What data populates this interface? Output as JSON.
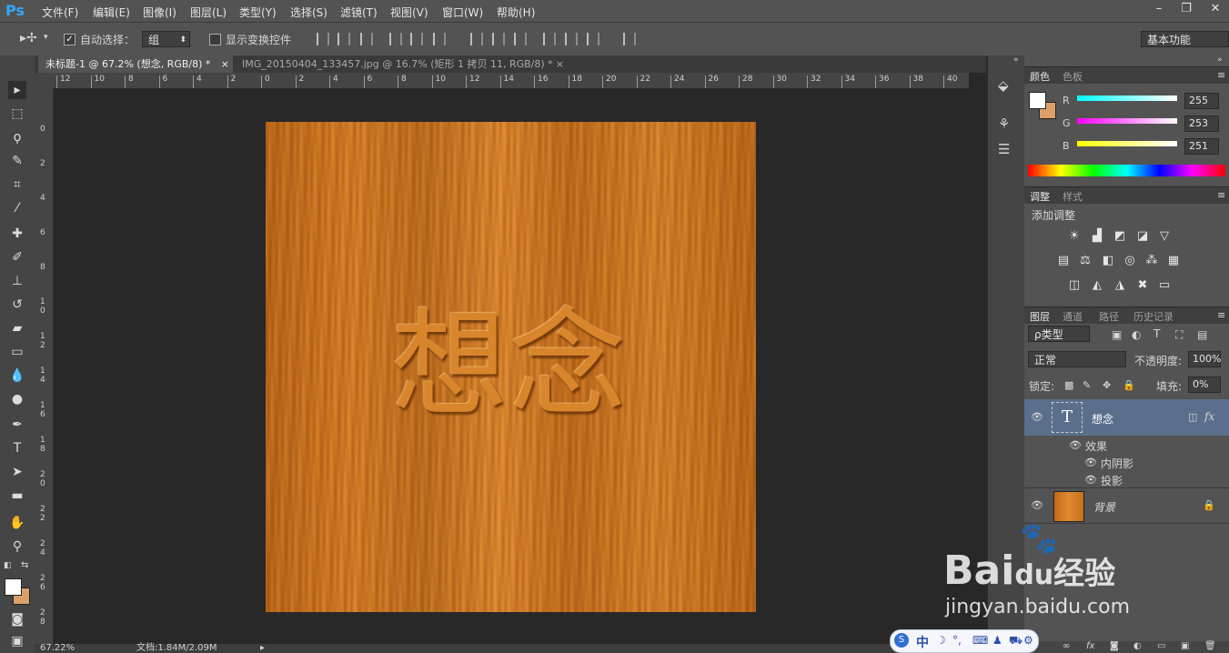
{
  "app": {
    "logo": "Ps"
  },
  "menu": [
    "文件(F)",
    "编辑(E)",
    "图像(I)",
    "图层(L)",
    "类型(Y)",
    "选择(S)",
    "滤镜(T)",
    "视图(V)",
    "窗口(W)",
    "帮助(H)"
  ],
  "window_controls": {
    "minimize": "–",
    "restore": "❐",
    "close": "✕"
  },
  "options": {
    "auto_select_label": "自动选择：",
    "auto_select_checked": true,
    "auto_select_value": "组",
    "show_transform_label": "显示变换控件",
    "show_transform_checked": false,
    "workspace": "基本功能"
  },
  "tabs": [
    {
      "label": "未标题-1 @ 67.2% (想念, RGB/8) *",
      "active": true
    },
    {
      "label": "IMG_20150404_133457.jpg @ 16.7% (矩形 1 拷贝 11, RGB/8) *",
      "active": false
    }
  ],
  "ruler_h": [
    "12",
    "10",
    "8",
    "6",
    "4",
    "2",
    "0",
    "2",
    "4",
    "6",
    "8",
    "10",
    "12",
    "14",
    "16",
    "18",
    "20",
    "22",
    "24",
    "26",
    "28",
    "30",
    "32",
    "34",
    "36",
    "38",
    "40"
  ],
  "ruler_v": [
    "0",
    "2",
    "4",
    "6",
    "8",
    "1\n0",
    "1\n2",
    "1\n4",
    "1\n6",
    "1\n8",
    "2\n0",
    "2\n2",
    "2\n4",
    "2\n6",
    "2\n8"
  ],
  "canvas": {
    "text": "想念"
  },
  "status": {
    "zoom": "67.22%",
    "doc": "文档:1.84M/2.09M"
  },
  "color_panel": {
    "tabs": [
      "颜色",
      "色板"
    ],
    "r_label": "R",
    "r": "255",
    "g_label": "G",
    "g": "253",
    "b_label": "B",
    "b": "251"
  },
  "adjust_panel": {
    "tabs": [
      "调整",
      "样式"
    ],
    "title": "添加调整"
  },
  "layers_panel": {
    "tabs": [
      "图层",
      "通道",
      "路径",
      "历史记录"
    ],
    "filter": "ρ类型",
    "blend_mode": "正常",
    "opacity_label": "不透明度:",
    "opacity": "100%",
    "lock_label": "锁定:",
    "fill_label": "填充:",
    "fill": "0%",
    "layers": [
      {
        "name": "想念",
        "type": "text",
        "effects_label": "效果",
        "effects": [
          "内阴影",
          "投影"
        ],
        "fx": "fx"
      },
      {
        "name": "背景",
        "type": "image"
      }
    ]
  },
  "watermark": {
    "brand": "Bai",
    "brand2": "du",
    "cn": "经验",
    "url": "jingyan.baidu.com"
  },
  "ime": {
    "lang": "中"
  },
  "colors": {
    "accent": "#31a8ff",
    "wood": "#d27a24"
  }
}
